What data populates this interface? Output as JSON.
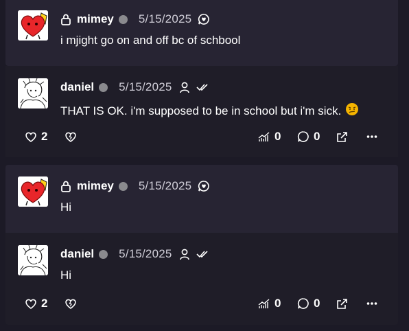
{
  "messages": [
    {
      "author": "mimey",
      "date": "5/15/2025",
      "text": "i mjight go on and off bc of schbool",
      "locked": true,
      "header_icon": "chat-heart-icon",
      "avatar": "red-heart-avatar"
    },
    {
      "author": "daniel",
      "date": "5/15/2025",
      "text": "THAT IS OK. i'm supposed to be in school but i'm sick.",
      "emoji": "sick-face-emoji",
      "header_icons": [
        "user-icon",
        "double-check-icon"
      ],
      "avatar": "sketch-avatar",
      "actions": {
        "likes": "2",
        "views": "0",
        "replies": "0"
      }
    },
    {
      "author": "mimey",
      "date": "5/15/2025",
      "text": "Hi",
      "locked": true,
      "header_icon": "chat-heart-icon",
      "avatar": "red-heart-avatar"
    },
    {
      "author": "daniel",
      "date": "5/15/2025",
      "text": "Hi",
      "header_icons": [
        "user-icon",
        "double-check-icon"
      ],
      "avatar": "sketch-avatar",
      "actions": {
        "likes": "2",
        "views": "0",
        "replies": "0"
      }
    }
  ],
  "colors": {
    "background": "#1c1a26",
    "card": "#272433",
    "card_alt": "#1f1d28",
    "status_offline": "#8a8a8e",
    "emoji": "#f5b400"
  }
}
